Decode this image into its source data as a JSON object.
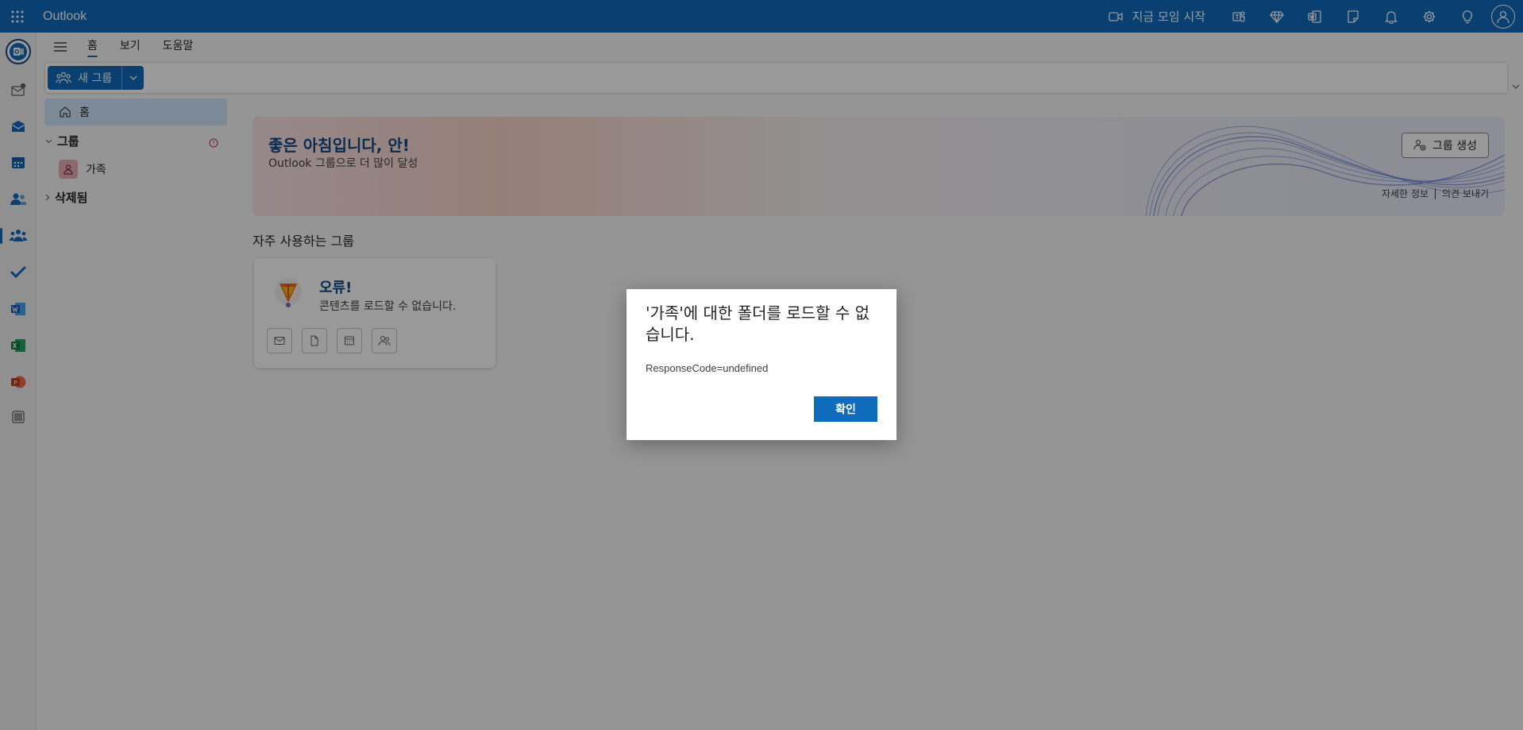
{
  "app": {
    "title": "Outlook"
  },
  "topbar": {
    "meet_now": "지금 모임 시작"
  },
  "ribbon": {
    "tabs": [
      {
        "label": "홈",
        "active": true
      },
      {
        "label": "보기",
        "active": false
      },
      {
        "label": "도움말",
        "active": false
      }
    ],
    "new_group": "새 그룹"
  },
  "folder_pane": {
    "home": "홈",
    "groups_label": "그룹",
    "group_items": [
      {
        "label": "가족"
      }
    ],
    "deleted_label": "삭제됨"
  },
  "banner": {
    "greeting": "좋은 아침입니다, 안!",
    "subtitle": "Outlook 그룹으로 더 많이 달성",
    "create_group": "그룹 생성",
    "learn_more": "자세한 정보",
    "feedback": "의견 보내기"
  },
  "frequent": {
    "title": "자주 사용하는 그룹",
    "card_title": "오류!",
    "card_desc": "콘텐츠를 로드할 수 없습니다."
  },
  "dialog": {
    "title": "'가족'에 대한 폴더를 로드할 수 없습니다.",
    "message": "ResponseCode=undefined",
    "ok": "확인"
  },
  "colors": {
    "brand": "#0f6cbd",
    "selected": "#cfe4fa"
  }
}
